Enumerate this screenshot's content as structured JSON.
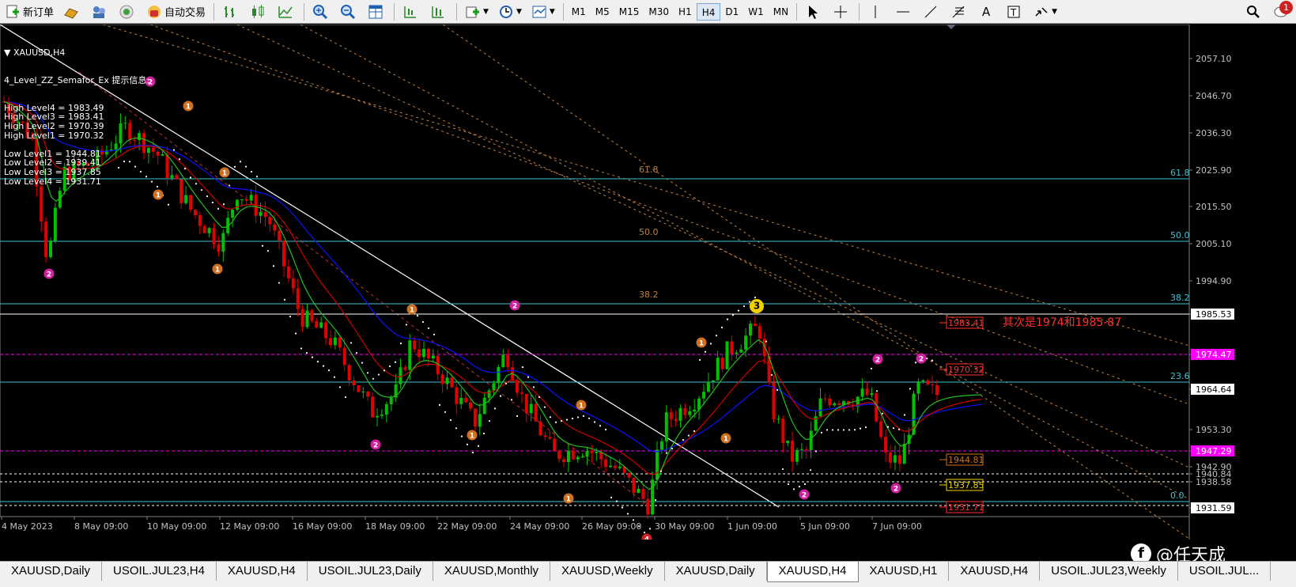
{
  "toolbar": {
    "new_order": "新订单",
    "auto_trade": "自动交易",
    "timeframes": [
      "M1",
      "M5",
      "M15",
      "M30",
      "H1",
      "H4",
      "D1",
      "W1",
      "MN"
    ],
    "active_timeframe": "H4",
    "notifications": "1"
  },
  "chart": {
    "symbol_title": "XAUUSD,H4",
    "indicator_title": "4_Level_ZZ_Semafor_Ex 提示信息:",
    "levels": [
      "High Level4 = 1983.49",
      "High Level3 = 1983.41",
      "High Level2 = 1970.39",
      "High Level1 = 1970.32",
      "",
      "Low Level1 = 1944.81",
      "Low Level2 = 1939.41",
      "Low Level3 = 1937.85",
      "Low Level4 = 1931.71"
    ],
    "price_axis": [
      "2057.10",
      "2046.70",
      "2036.30",
      "2025.90",
      "2015.50",
      "2005.10",
      "1994.90",
      "1985.53",
      "1974.47",
      "1964.64",
      "1953.30",
      "1947.29",
      "1942.90",
      "1940.84",
      "1938.58",
      "1931.59"
    ],
    "date_axis": [
      "4 May 2023",
      "8 May 09:00",
      "10 May 09:00",
      "12 May 09:00",
      "16 May 09:00",
      "18 May 09:00",
      "22 May 09:00",
      "24 May 09:00",
      "26 May 09:00",
      "30 May 09:00",
      "1 Jun 09:00",
      "5 Jun 09:00",
      "7 Jun 09:00"
    ],
    "fib_labels": [
      "61.8",
      "50.0",
      "38.2",
      "23.6",
      "0.0"
    ],
    "fib_right_labels": [
      "61.8",
      "50.0",
      "38.2",
      "23.6",
      "0.0"
    ],
    "annotation": "其次是1974和1985-87",
    "level_boxes": [
      "1983.41",
      "1970.32",
      "1944.81",
      "1937.85",
      "1931.71"
    ],
    "colors": {
      "bull": "#00c000",
      "bear": "#e00000",
      "fib": "#40c0d0",
      "pink": "#ff00ff",
      "ma_blue": "#1010ff",
      "ma_red": "#d00000",
      "ma_green": "#20c020"
    }
  },
  "tabs": [
    "XAUUSD,Daily",
    "USOIL.JUL23,H4",
    "XAUUSD,H4",
    "USOIL.JUL23,Daily",
    "XAUUSD,Monthly",
    "XAUUSD,Weekly",
    "XAUUSD,Daily",
    "XAUUSD,H4",
    "XAUUSD,H1",
    "XAUUSD,H4",
    "USOIL.JUL23,Weekly",
    "USOIL.JUL..."
  ],
  "active_tab_index": 7,
  "watermark": "@任天成"
}
